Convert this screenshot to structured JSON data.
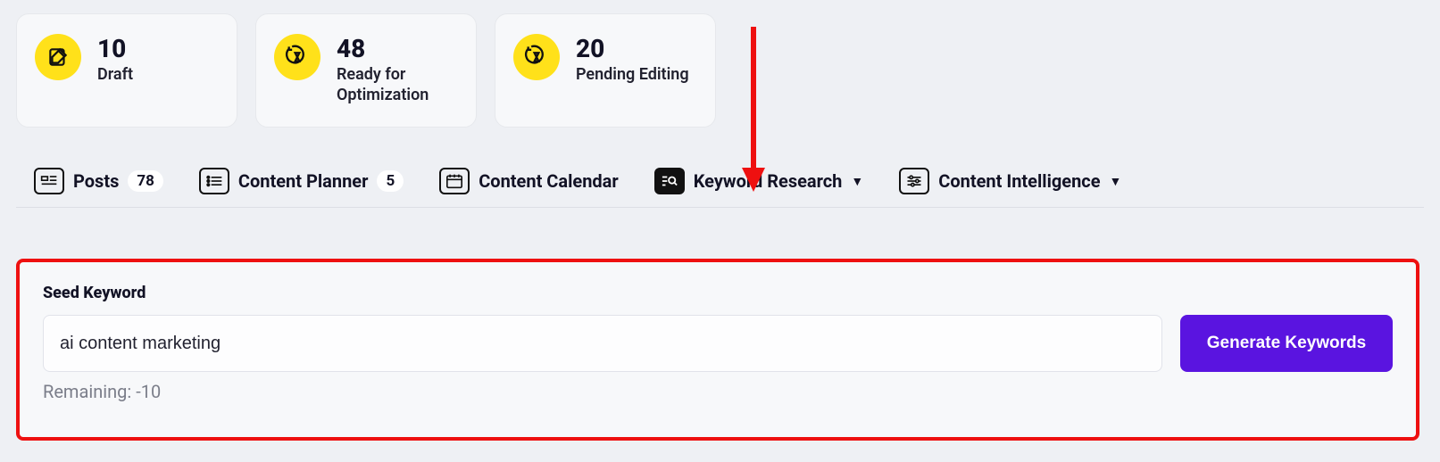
{
  "stats": [
    {
      "count": "10",
      "label": "Draft"
    },
    {
      "count": "48",
      "label": "Ready for Optimization"
    },
    {
      "count": "20",
      "label": "Pending Editing"
    }
  ],
  "tabs": {
    "posts": {
      "label": "Posts",
      "badge": "78"
    },
    "planner": {
      "label": "Content Planner",
      "badge": "5"
    },
    "calendar": {
      "label": "Content Calendar"
    },
    "keyword": {
      "label": "Keyword Research"
    },
    "intelligence": {
      "label": "Content Intelligence"
    }
  },
  "form": {
    "field_label": "Seed Keyword",
    "value": "ai content marketing",
    "button": "Generate Keywords",
    "remaining": "Remaining: -10"
  }
}
